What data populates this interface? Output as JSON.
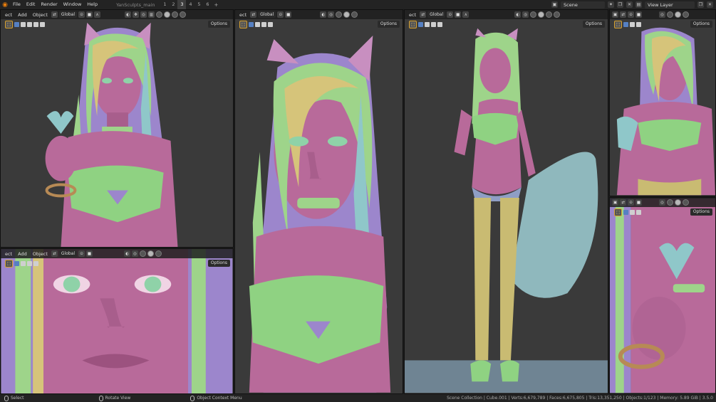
{
  "topbar": {
    "menus": [
      "File",
      "Edit",
      "Render",
      "Window",
      "Help"
    ],
    "file_name": "YanSculpts_main",
    "workspace_tabs": [
      "1",
      "2",
      "3",
      "4",
      "5",
      "6"
    ],
    "active_tab_index": 2,
    "add_tab": "+",
    "scene": "Scene",
    "view_layer": "View Layer"
  },
  "viewport_header": {
    "menus_full": [
      "ect",
      "Add",
      "Object"
    ],
    "menus_short": [
      "ect"
    ],
    "transform_orientation": "Global",
    "options_label": "Options"
  },
  "status": {
    "select": "Select",
    "rotate_view": "Rotate View",
    "context_menu": "Object Context Menu",
    "stats": "Scene Collection | Cube.001 | Verts:6,679,789 | Faces:6,675,805 | Tris:13,351,250 | Objects:1/123 | Memory: 5.89 GiB | 3.5.0"
  },
  "colors": {
    "background": "#3a3a3a",
    "skin": "#b86a9a",
    "hair_green": "#9ed48a",
    "hair_yellow": "#d6c47a",
    "hair_purple": "#9c86cc",
    "top_green": "#8fd282",
    "leg_yellow": "#c9bb72",
    "tail": "#8fb8bd",
    "accent": "#e87d0d"
  }
}
